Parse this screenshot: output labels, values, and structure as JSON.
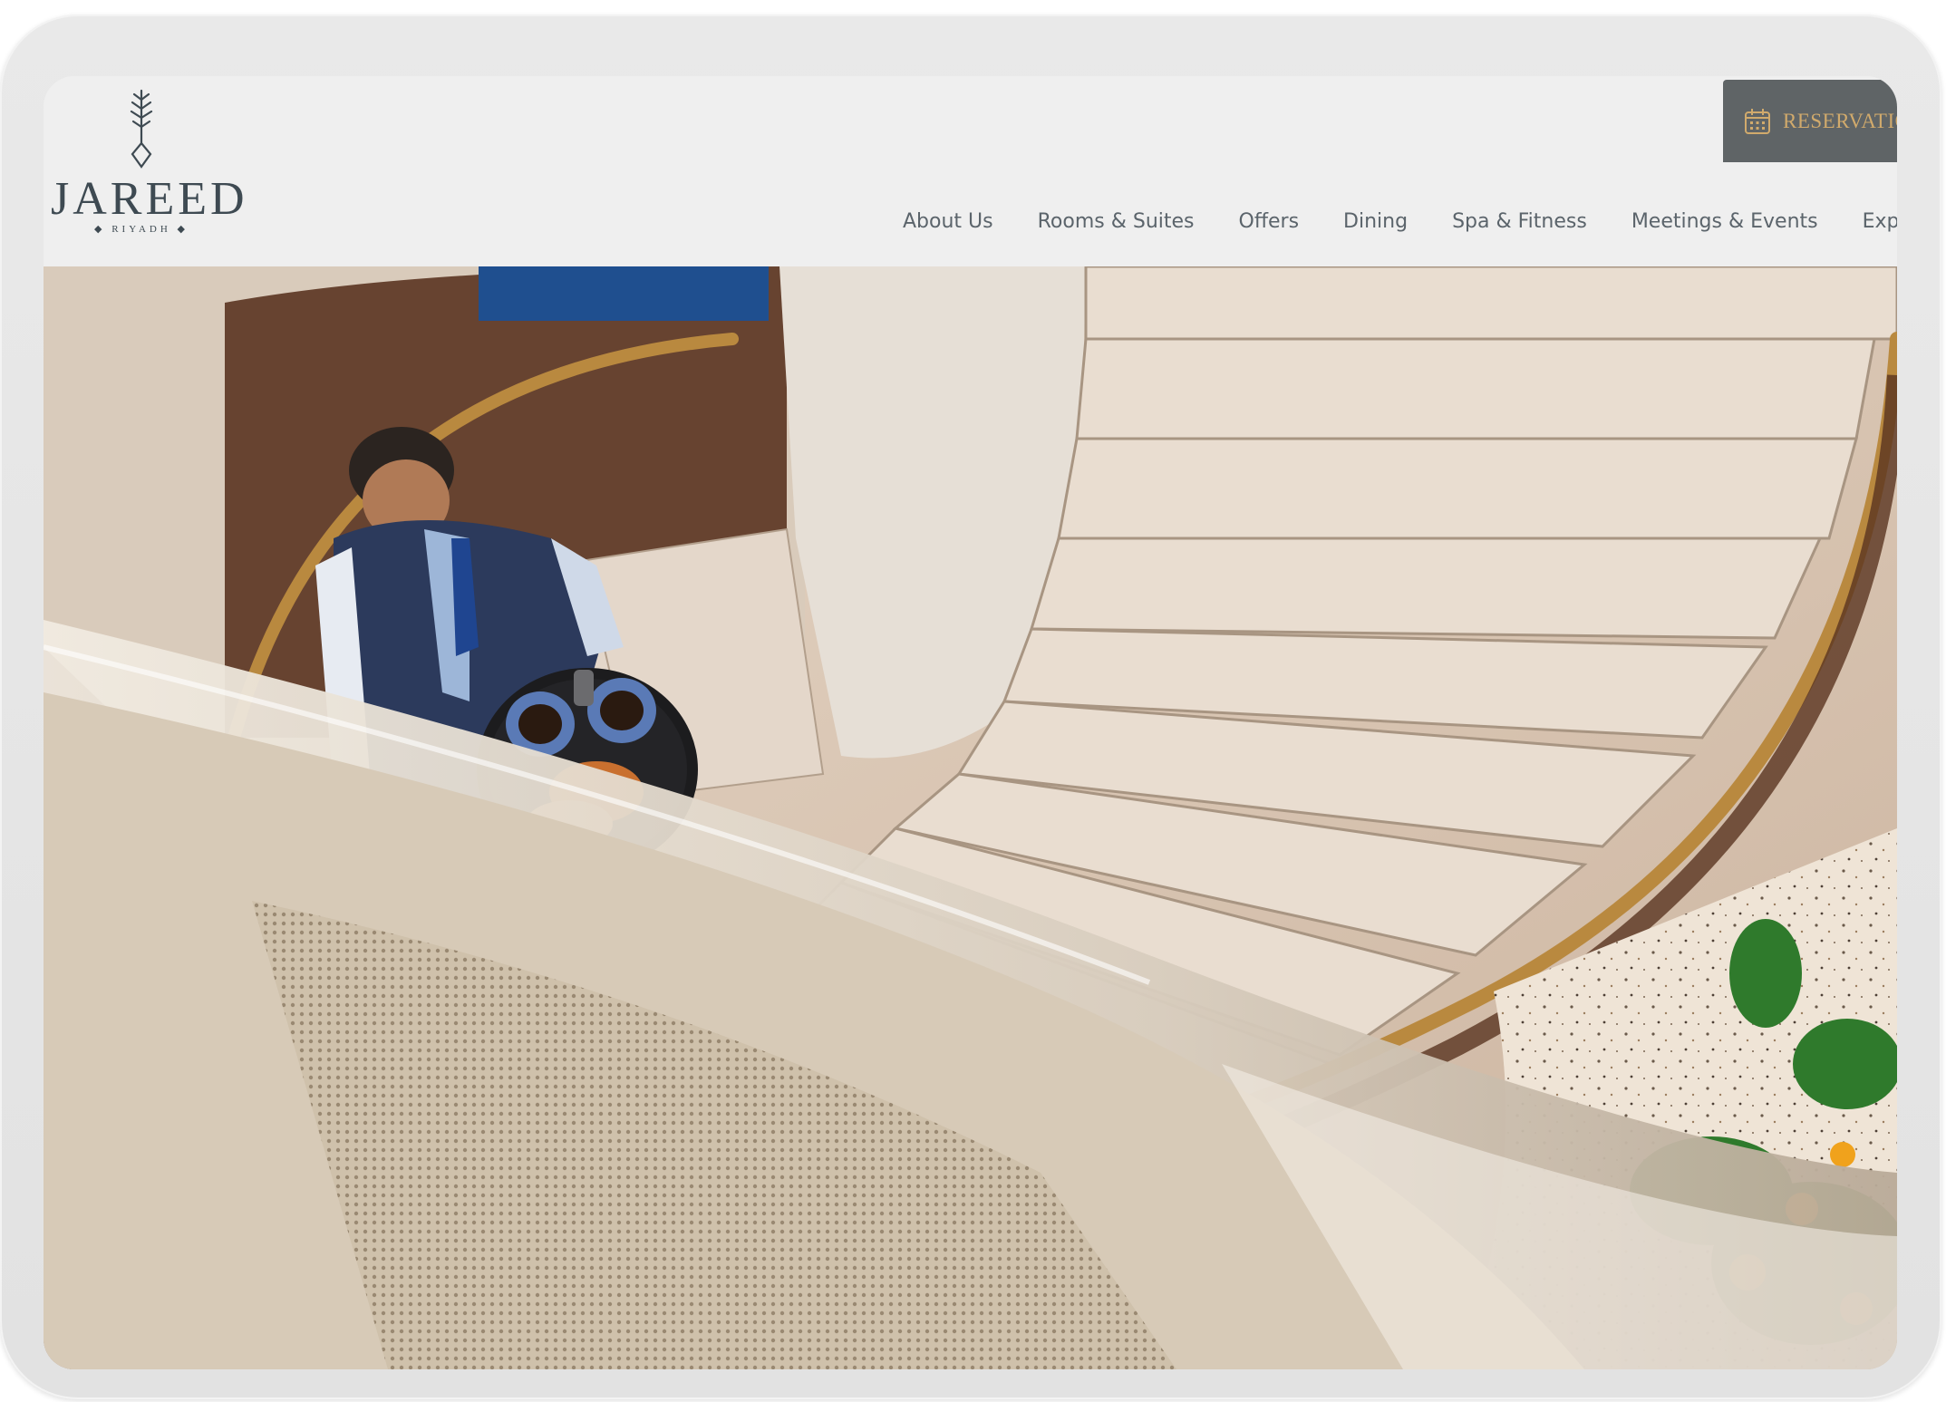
{
  "header": {
    "logo": {
      "word": "JAREED",
      "sub": "RIYADH"
    },
    "reservations_label": "RESERVATIONS",
    "nav": [
      "About Us",
      "Rooms & Suites",
      "Offers",
      "Dining",
      "Spa & Fitness",
      "Meetings & Events",
      "Experiences"
    ]
  },
  "hero": {
    "image": "spiral-staircase-waiter-photo"
  },
  "colors": {
    "header_bg": "#efefef",
    "logo_text": "#3e4a52",
    "nav_text": "#5b646b",
    "reservations_bg": "#5f6466",
    "reservations_text": "#d1aa6c",
    "device_frame": "#e6e6e6"
  },
  "icons": {
    "logo_mark": "tree-key-icon",
    "reservations": "calendar-icon"
  }
}
